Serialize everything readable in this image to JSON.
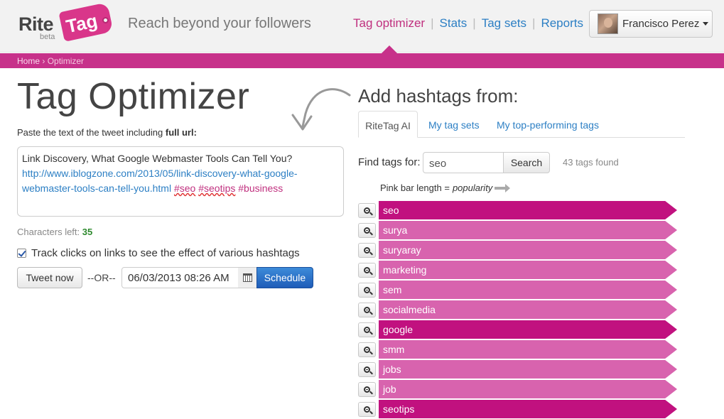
{
  "brand": {
    "name_part1": "Rite",
    "name_part2": "Tag",
    "beta": "beta",
    "tagline": "Reach beyond your followers"
  },
  "nav": {
    "items": [
      {
        "label": "Tag optimizer",
        "active": true
      },
      {
        "label": "Stats",
        "active": false
      },
      {
        "label": "Tag sets",
        "active": false
      },
      {
        "label": "Reports",
        "active": false
      }
    ],
    "separator": "|"
  },
  "user": {
    "name": "Francisco Perez"
  },
  "breadcrumb": {
    "home": "Home",
    "separator": "›",
    "current": "Optimizer"
  },
  "optimizer": {
    "title": "Tag Optimizer",
    "paste_label": "Paste the text of the tweet including",
    "paste_label_bold": "full url:",
    "tweet_text": "Link Discovery, What Google Webmaster Tools Can Tell You?",
    "tweet_link": "http://www.iblogzone.com/2013/05/link-discovery-what-google-webmaster-tools-can-tell-you.html",
    "tweet_hashtags": [
      "#seo",
      "#seotips",
      "#business"
    ],
    "chars_left_label": "Characters left:",
    "chars_left_value": "35",
    "track_label": "Track clicks on links to see the effect of various hashtags",
    "track_checked": true,
    "tweet_now_label": "Tweet now",
    "or_label": "--OR--",
    "schedule_datetime": "06/03/2013 08:26 AM",
    "schedule_label": "Schedule"
  },
  "hashtags": {
    "title": "Add hashtags from:",
    "tabs": [
      {
        "label": "RiteTag AI",
        "active": true
      },
      {
        "label": "My tag sets",
        "active": false
      },
      {
        "label": "My top-performing tags",
        "active": false
      }
    ],
    "find_label": "Find tags for:",
    "search_value": "seo",
    "search_button": "Search",
    "found_text": "43 tags found",
    "legend_prefix": "Pink bar length =",
    "legend_word": "popularity",
    "colors": {
      "strong": "#c1117f",
      "medium": "#d863ae"
    },
    "tags": [
      {
        "name": "seo",
        "strength": "strong"
      },
      {
        "name": "surya",
        "strength": "medium"
      },
      {
        "name": "suryaray",
        "strength": "medium"
      },
      {
        "name": "marketing",
        "strength": "medium"
      },
      {
        "name": "sem",
        "strength": "medium"
      },
      {
        "name": "socialmedia",
        "strength": "medium"
      },
      {
        "name": "google",
        "strength": "strong"
      },
      {
        "name": "smm",
        "strength": "medium"
      },
      {
        "name": "jobs",
        "strength": "medium"
      },
      {
        "name": "job",
        "strength": "medium"
      },
      {
        "name": "seotips",
        "strength": "strong"
      }
    ]
  }
}
